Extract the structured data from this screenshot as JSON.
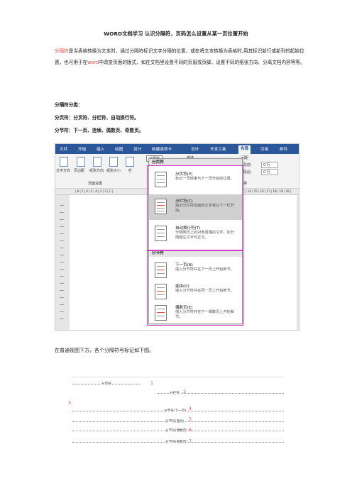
{
  "title": "WORD文档学习 认识分隔符，页码怎么设置从某一页位置开始",
  "intro": {
    "highlight": "分隔符",
    "text1": "是当表格转换为文本时，通过分隔符标识文字分隔的位置，或在将文本转换为表格时,用",
    "text2": "其标识新行或新列的起始位置，也可用于在",
    "word": "word",
    "text3": "中改变页面的版式，如在文档里设置不同的",
    "text4": "页眉或页脚、设置不同的纸张方向、分离文档内容等等。"
  },
  "heading_types": "分隔符分类：",
  "page_break_line": "分页符：分页符、分栏符、自动换行符。",
  "section_break_line": "分节符：下一页、连续、偶数页、奇数页。",
  "screenshot1": {
    "tabs": [
      "文件",
      "开始",
      "插入",
      "绘图",
      "设计",
      "新建选项卡",
      "设计",
      "开发工具",
      "布局",
      "引用",
      "邮件"
    ],
    "ribbon_buttons": [
      "文字方向",
      "页边距",
      "纸张方向",
      "纸张大小",
      "栏"
    ],
    "dropdown_label": "分隔符",
    "indent_label": "缩进",
    "spacing_label": "间距",
    "before_label": "段前:",
    "before_value": "0 行",
    "after_label": "段后:",
    "after_value": "0 行",
    "group_label": "页面设置",
    "arrange_label": "排",
    "ruler_text": "| 8 | 7 | 6 | 5 | 4 | 3 | 2 | 1 |",
    "ruler_right": "| 14 | 15 | 16 | 17 | 18 | 19 | 20 |",
    "menu": {
      "page_section_header": "分页符",
      "section_header": "分节符",
      "items": [
        {
          "title": "分页符(P)",
          "desc": "标记一页结束与下一页开始的位置。"
        },
        {
          "title": "分栏符(C)",
          "desc": "指示分栏符后面的文字将从下一栏开始。"
        },
        {
          "title": "自动换行符(T)",
          "desc": "分隔网页上的对象周围的文字，如分隔题注文字与正文。"
        },
        {
          "title": "下一页(N)",
          "desc": "插入分节符并在下一页上开始新节。"
        },
        {
          "title": "连续(O)",
          "desc": "插入分节符并在同一页上开始新节。"
        },
        {
          "title": "偶数页(E)",
          "desc": "插入分节符并在下一偶数页上开始新节。"
        }
      ]
    }
  },
  "caption": "在普通视图下方，各个分隔符号标记如下图。",
  "screenshot2": {
    "breaks": [
      "分页符",
      "分栏符",
      "分节符(下一页)",
      "分节符(连续)",
      "分节符(偶数页)",
      "分节符(奇数页)"
    ],
    "numbers": [
      "1",
      "2",
      "3",
      "4",
      "5",
      "6",
      "7"
    ]
  }
}
